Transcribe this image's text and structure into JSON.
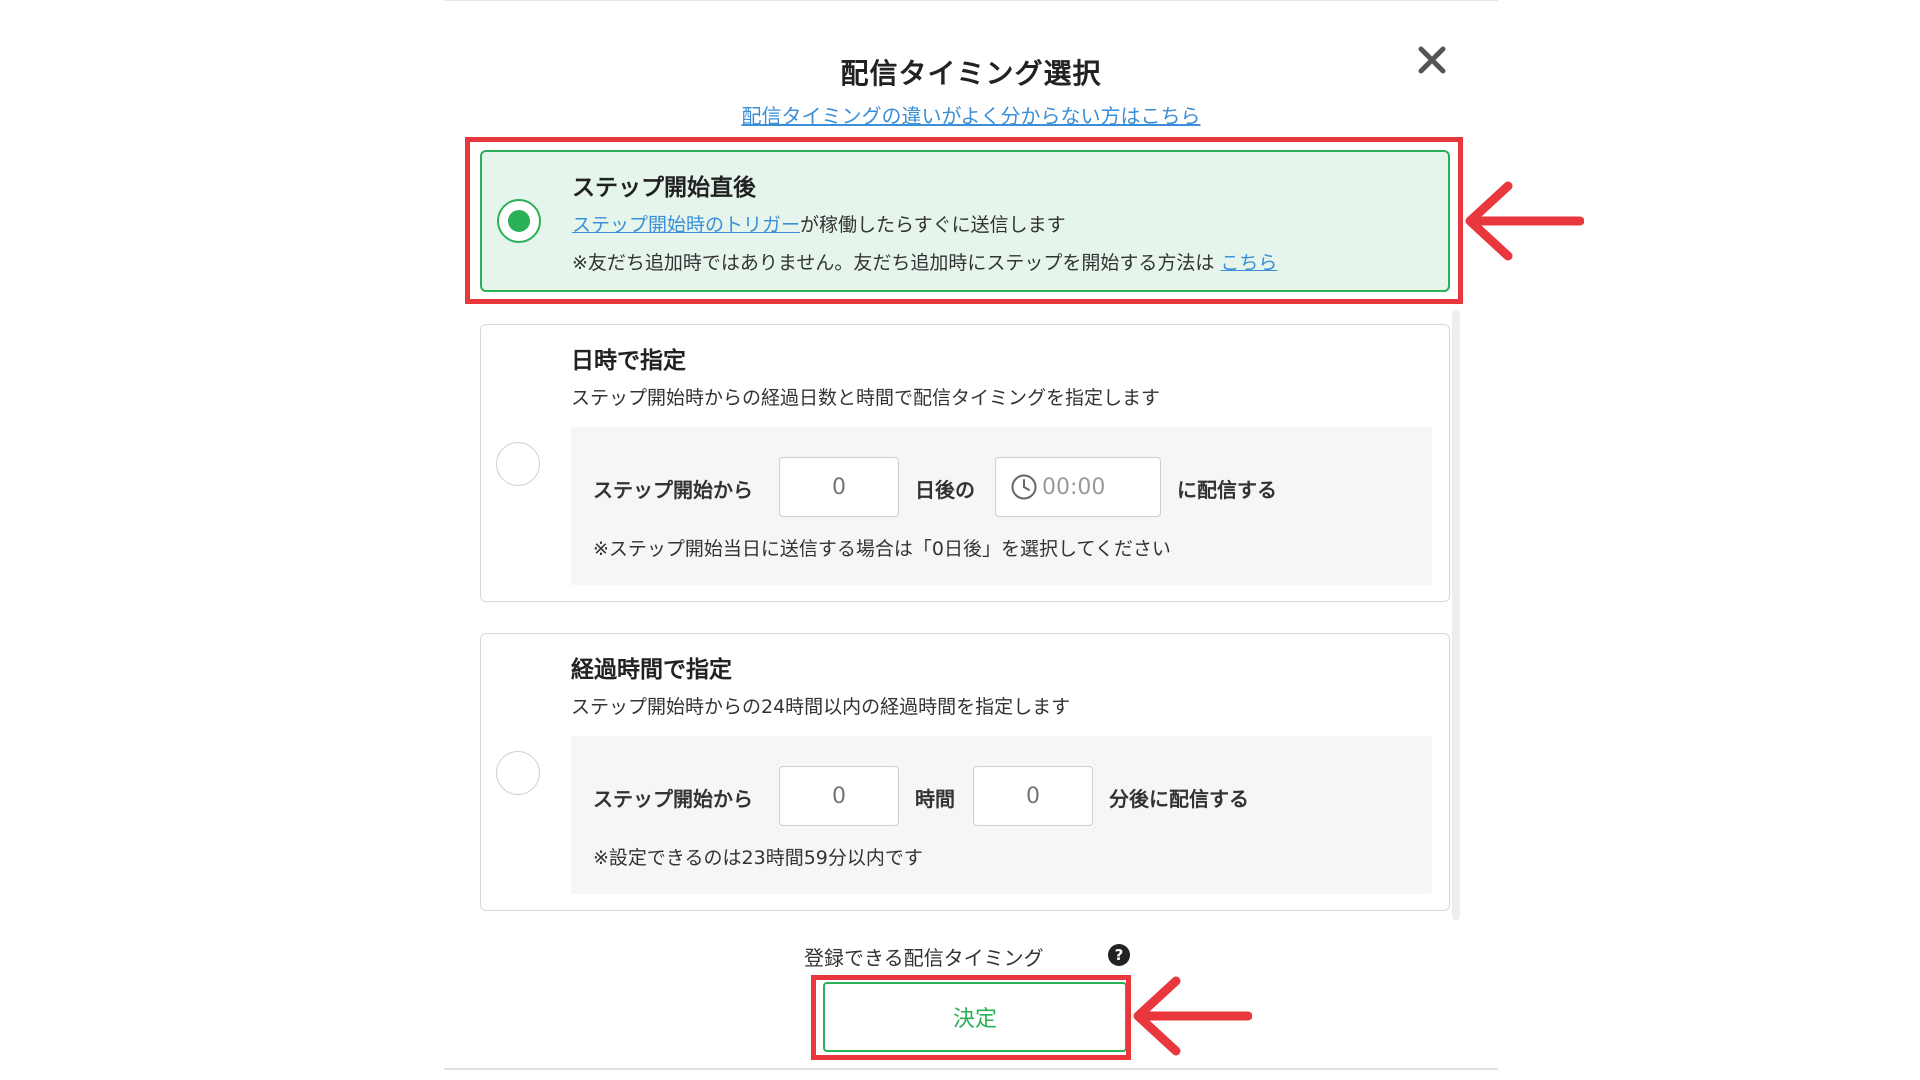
{
  "dialog": {
    "title": "配信タイミング選択",
    "help_link": "配信タイミングの違いがよく分からない方はこちら",
    "close_icon": "close-icon"
  },
  "options": [
    {
      "title": "ステップ開始直後",
      "selected": true,
      "desc_link": "ステップ開始時のトリガー",
      "desc_rest": "が稼働したらすぐに送信します",
      "note": "※友だち追加時ではありません。友だち追加時にステップを開始する方法は",
      "note_link": "こちら"
    },
    {
      "title": "日時で指定",
      "selected": false,
      "desc": "ステップ開始時からの経過日数と時間で配信タイミングを指定します",
      "label_prefix": "ステップ開始から",
      "days_placeholder": "0",
      "label_mid": "日後の",
      "time_placeholder": "00:00",
      "label_suffix": "に配信する",
      "note": "※ステップ開始当日に送信する場合は「0日後」を選択してください"
    },
    {
      "title": "経過時間で指定",
      "selected": false,
      "desc": "ステップ開始時からの24時間以内の経過時間を指定します",
      "label_prefix": "ステップ開始から",
      "hours_placeholder": "0",
      "label_mid": "時間",
      "minutes_placeholder": "0",
      "label_suffix": "分後に配信する",
      "note": "※設定できるのは23時間59分以内です"
    }
  ],
  "footer": {
    "register_label": "登録できる配信タイミング",
    "help_icon": "question-circle-icon",
    "help_glyph": "?",
    "submit_label": "決定"
  },
  "colors": {
    "accent": "#2ab057",
    "selected_bg": "#e6f5ec",
    "link": "#3a8fd8",
    "annotation": "#e8373d"
  }
}
